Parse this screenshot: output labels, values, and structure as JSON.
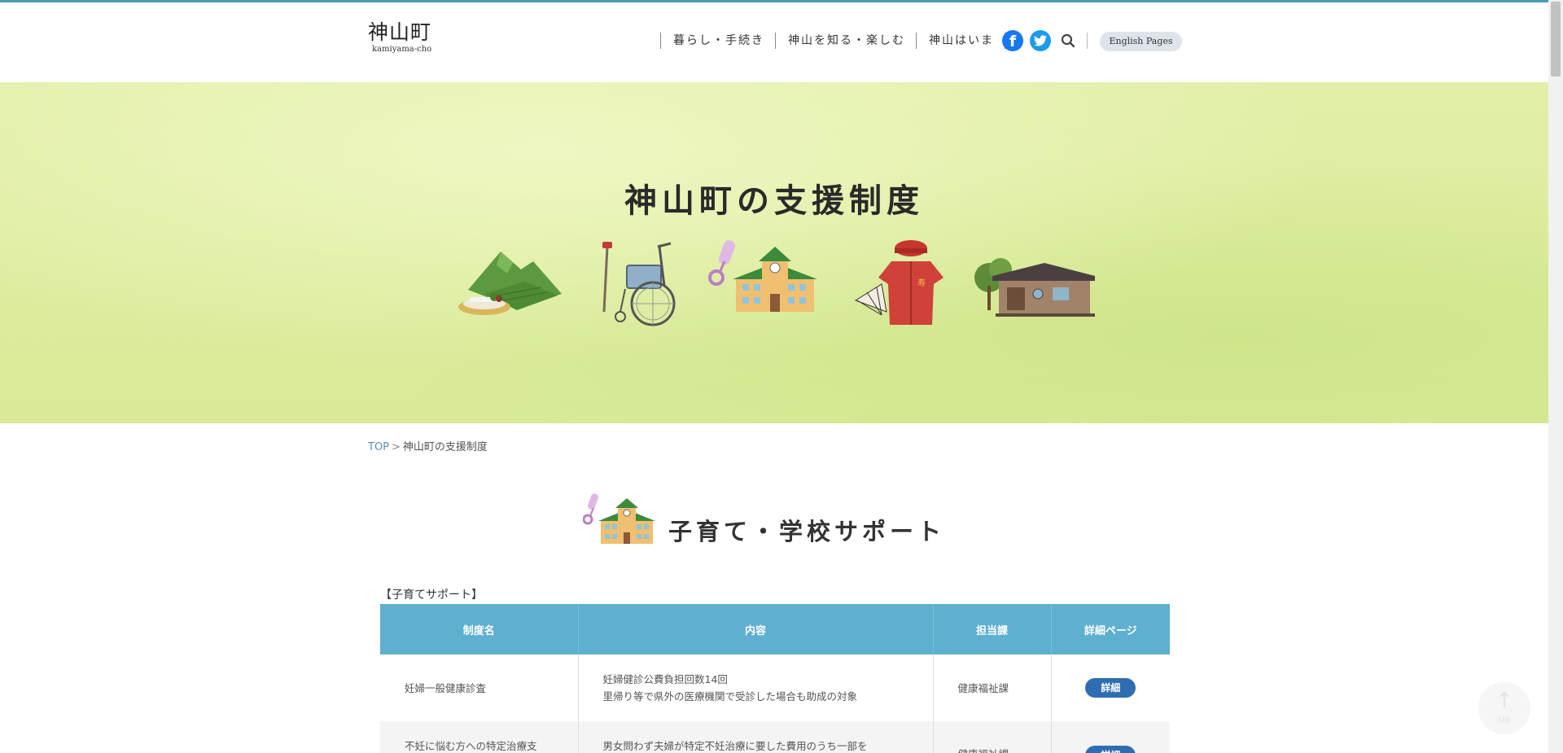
{
  "header": {
    "logo_main": "神山町",
    "logo_sub": "kamiyama-cho",
    "nav": [
      "暮らし・手続き",
      "神山を知る・楽しむ",
      "神山はいま"
    ],
    "english_label": "English Pages"
  },
  "hero": {
    "title": "神山町の支援制度"
  },
  "breadcrumb": {
    "top": "TOP",
    "separator": ">",
    "current": "神山町の支援制度"
  },
  "section": {
    "title": "子育て・学校サポート",
    "caption": "【子育てサポート】"
  },
  "table": {
    "headers": [
      "制度名",
      "内容",
      "担当課",
      "詳細ページ"
    ],
    "rows": [
      {
        "name": "妊婦一般健康診査",
        "content_line1": "妊婦健診公費負担回数14回",
        "content_line2": "里帰り等で県外の医療機関で受診した場合も助成の対象",
        "dept": "健康福祉課",
        "button": "詳細"
      },
      {
        "name": "不妊に悩む方への特定治療支",
        "content_line1": "男女問わず夫婦が特定不妊治療に要した費用のうち一部を",
        "content_line2": "",
        "dept": "健康福祉課",
        "button": "詳細"
      }
    ]
  },
  "up_button": {
    "label": "Up"
  },
  "colors": {
    "accent_line": "#4a9bb5",
    "table_header": "#5eafd0",
    "detail_button": "#2f6db3",
    "hero_bg": "#d8ea97"
  },
  "icons": [
    "facebook-icon",
    "twitter-icon",
    "search-icon",
    "arrow-up-icon"
  ]
}
